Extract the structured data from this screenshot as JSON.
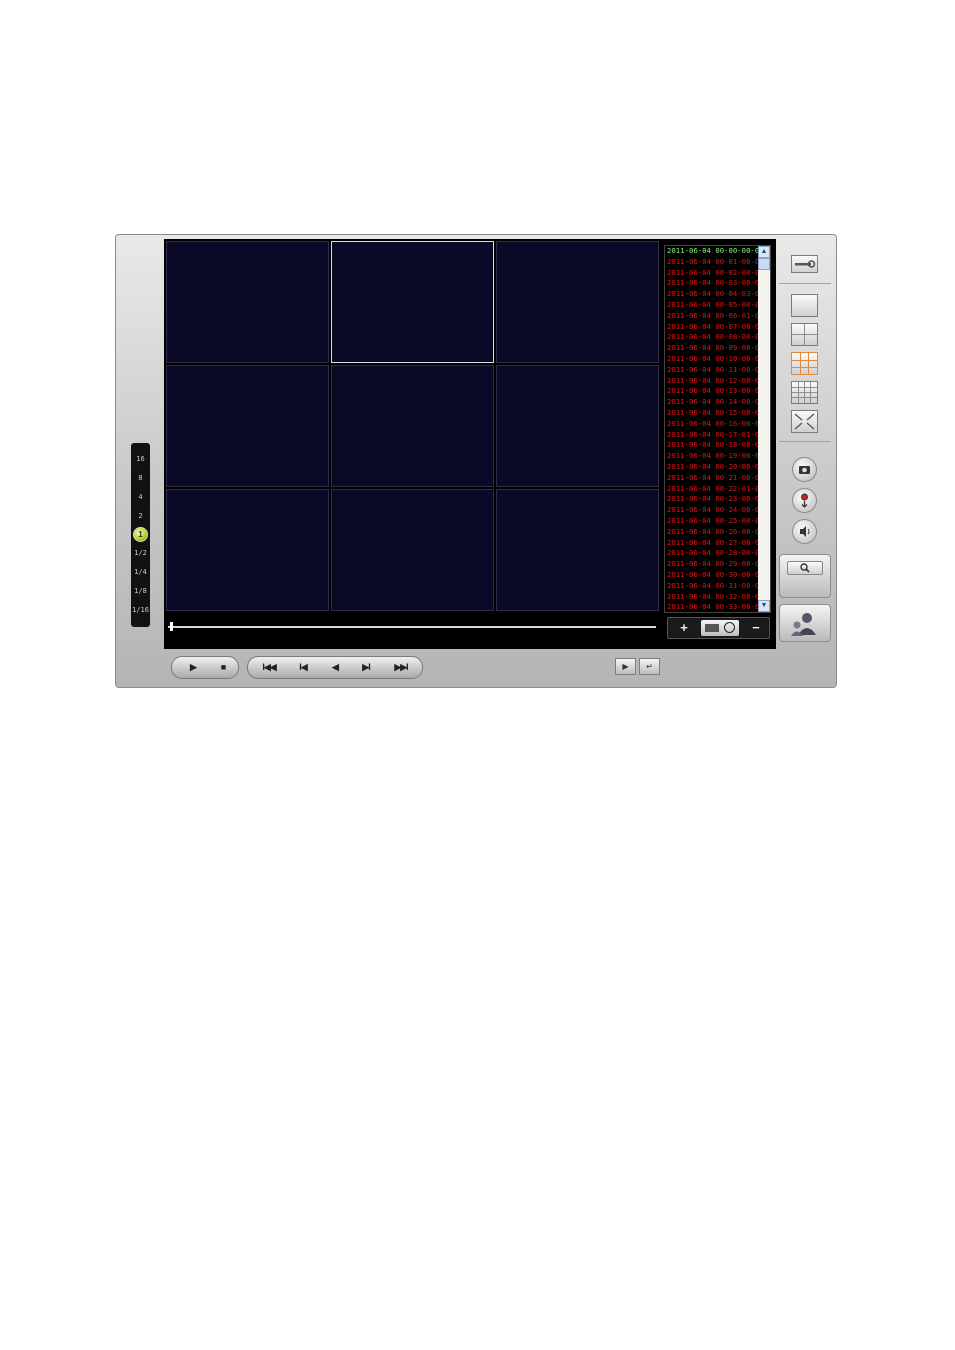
{
  "speed": {
    "ticks": [
      "16",
      "8",
      "4",
      "2",
      "1/2",
      "1/4",
      "1/8",
      "1/16"
    ],
    "selected": "1"
  },
  "layout": {
    "rows": 3,
    "cols": 3,
    "selected_cell": 2
  },
  "playback": {
    "progress": 0.0
  },
  "records": [
    "2011-06-04 00-00-00-0",
    "2011-06-04 00-01-00-0",
    "2011-06-04 00-02-00-0",
    "2011-06-04 00-03-00-0",
    "2011-06-04 00-04-03-0",
    "2011-06-04 00-05-00-0",
    "2011-06-04 00-06-01-0",
    "2011-06-04 00-07-00-0",
    "2011-06-04 00-08-00-0",
    "2011-06-04 00-09-00-0",
    "2011-06-04 00-10-00-0",
    "2011-06-04 00-11-00-0",
    "2011-06-04 00-12-00-0",
    "2011-06-04 00-13-00-0",
    "2011-06-04 00-14-00-0",
    "2011-06-04 00-15-00-0",
    "2011-06-04 00-16-00-0",
    "2011-06-04 00-17-01-0",
    "2011-06-04 00-18-00-0",
    "2011-06-04 00-19-00-0",
    "2011-06-04 00-20-00-0",
    "2011-06-04 00-21-00-0",
    "2011-06-04 00-22-01-0",
    "2011-06-04 00-23-00-0",
    "2011-06-04 00-24-00-0",
    "2011-06-04 00-25-00-0",
    "2011-06-04 00-26-00-0",
    "2011-06-04 00-27-00-0",
    "2011-06-04 00-28-00-0",
    "2011-06-04 00-29-00-0",
    "2011-06-04 00-30-00-0",
    "2011-06-04 00-31-00-0",
    "2011-06-04 00-32-00-0",
    "2011-06-04 00-33-00-0"
  ],
  "list_controls": {
    "add": "+",
    "remove": "−"
  },
  "transport": {
    "play": "▶",
    "stop": "■",
    "first": "I◀◀",
    "prev_frame": "I◀",
    "step_back": "◀",
    "next_frame": "▶I",
    "last": "▶▶I",
    "export": "▶",
    "enter": "↵"
  },
  "toolbar": {
    "icons": [
      "wrench-icon",
      "layout-1-icon",
      "layout-4-icon",
      "layout-9-icon",
      "layout-16-icon",
      "fullscreen-icon",
      "camera-icon",
      "record-icon",
      "speaker-icon",
      "search-icon",
      "user-icon"
    ],
    "accent": "#e08a3c"
  },
  "colors": {
    "record_normal": "#e01414",
    "record_current": "#8cf07a",
    "cell_bg": "#0a0a28"
  }
}
